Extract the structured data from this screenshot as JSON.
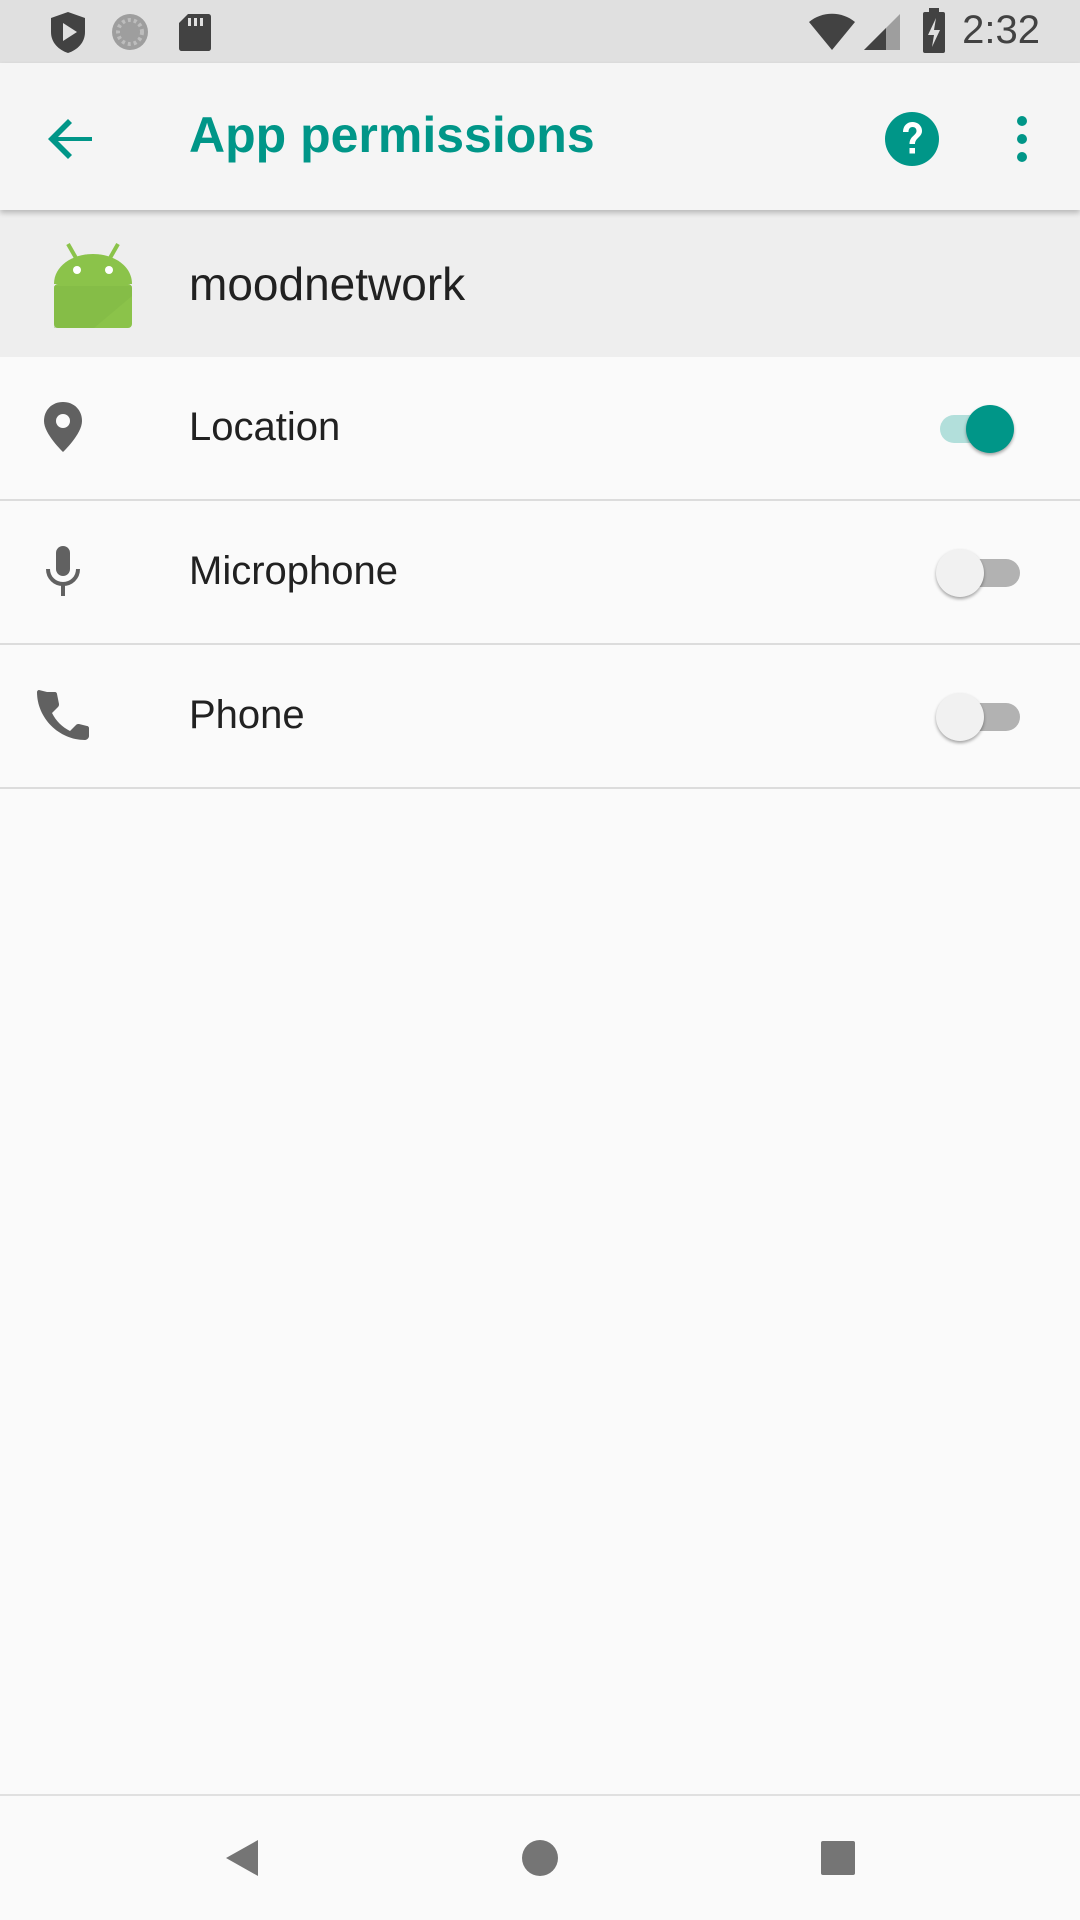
{
  "status_bar": {
    "time": "2:32",
    "icons": [
      "shield-play-icon",
      "sync-circle-icon",
      "sd-card-icon",
      "wifi-icon",
      "signal-icon",
      "battery-charging-icon"
    ]
  },
  "toolbar": {
    "title": "App permissions",
    "back_icon": "arrow-back-icon",
    "help_icon": "help-icon",
    "more_icon": "more-vert-icon"
  },
  "app": {
    "name": "moodnetwork",
    "icon": "android-icon"
  },
  "permissions": [
    {
      "label": "Location",
      "icon": "location-pin-icon",
      "enabled": true
    },
    {
      "label": "Microphone",
      "icon": "microphone-icon",
      "enabled": false
    },
    {
      "label": "Phone",
      "icon": "phone-icon",
      "enabled": false
    }
  ],
  "nav_bar": {
    "buttons": [
      "back-triangle-icon",
      "home-circle-icon",
      "recents-square-icon"
    ]
  },
  "colors": {
    "accent": "#009688",
    "toolbar_bg": "#f5f5f5",
    "header_bg": "#eeeeee",
    "status_bar_bg": "#e0e0e0",
    "icon_gray": "#616161"
  }
}
